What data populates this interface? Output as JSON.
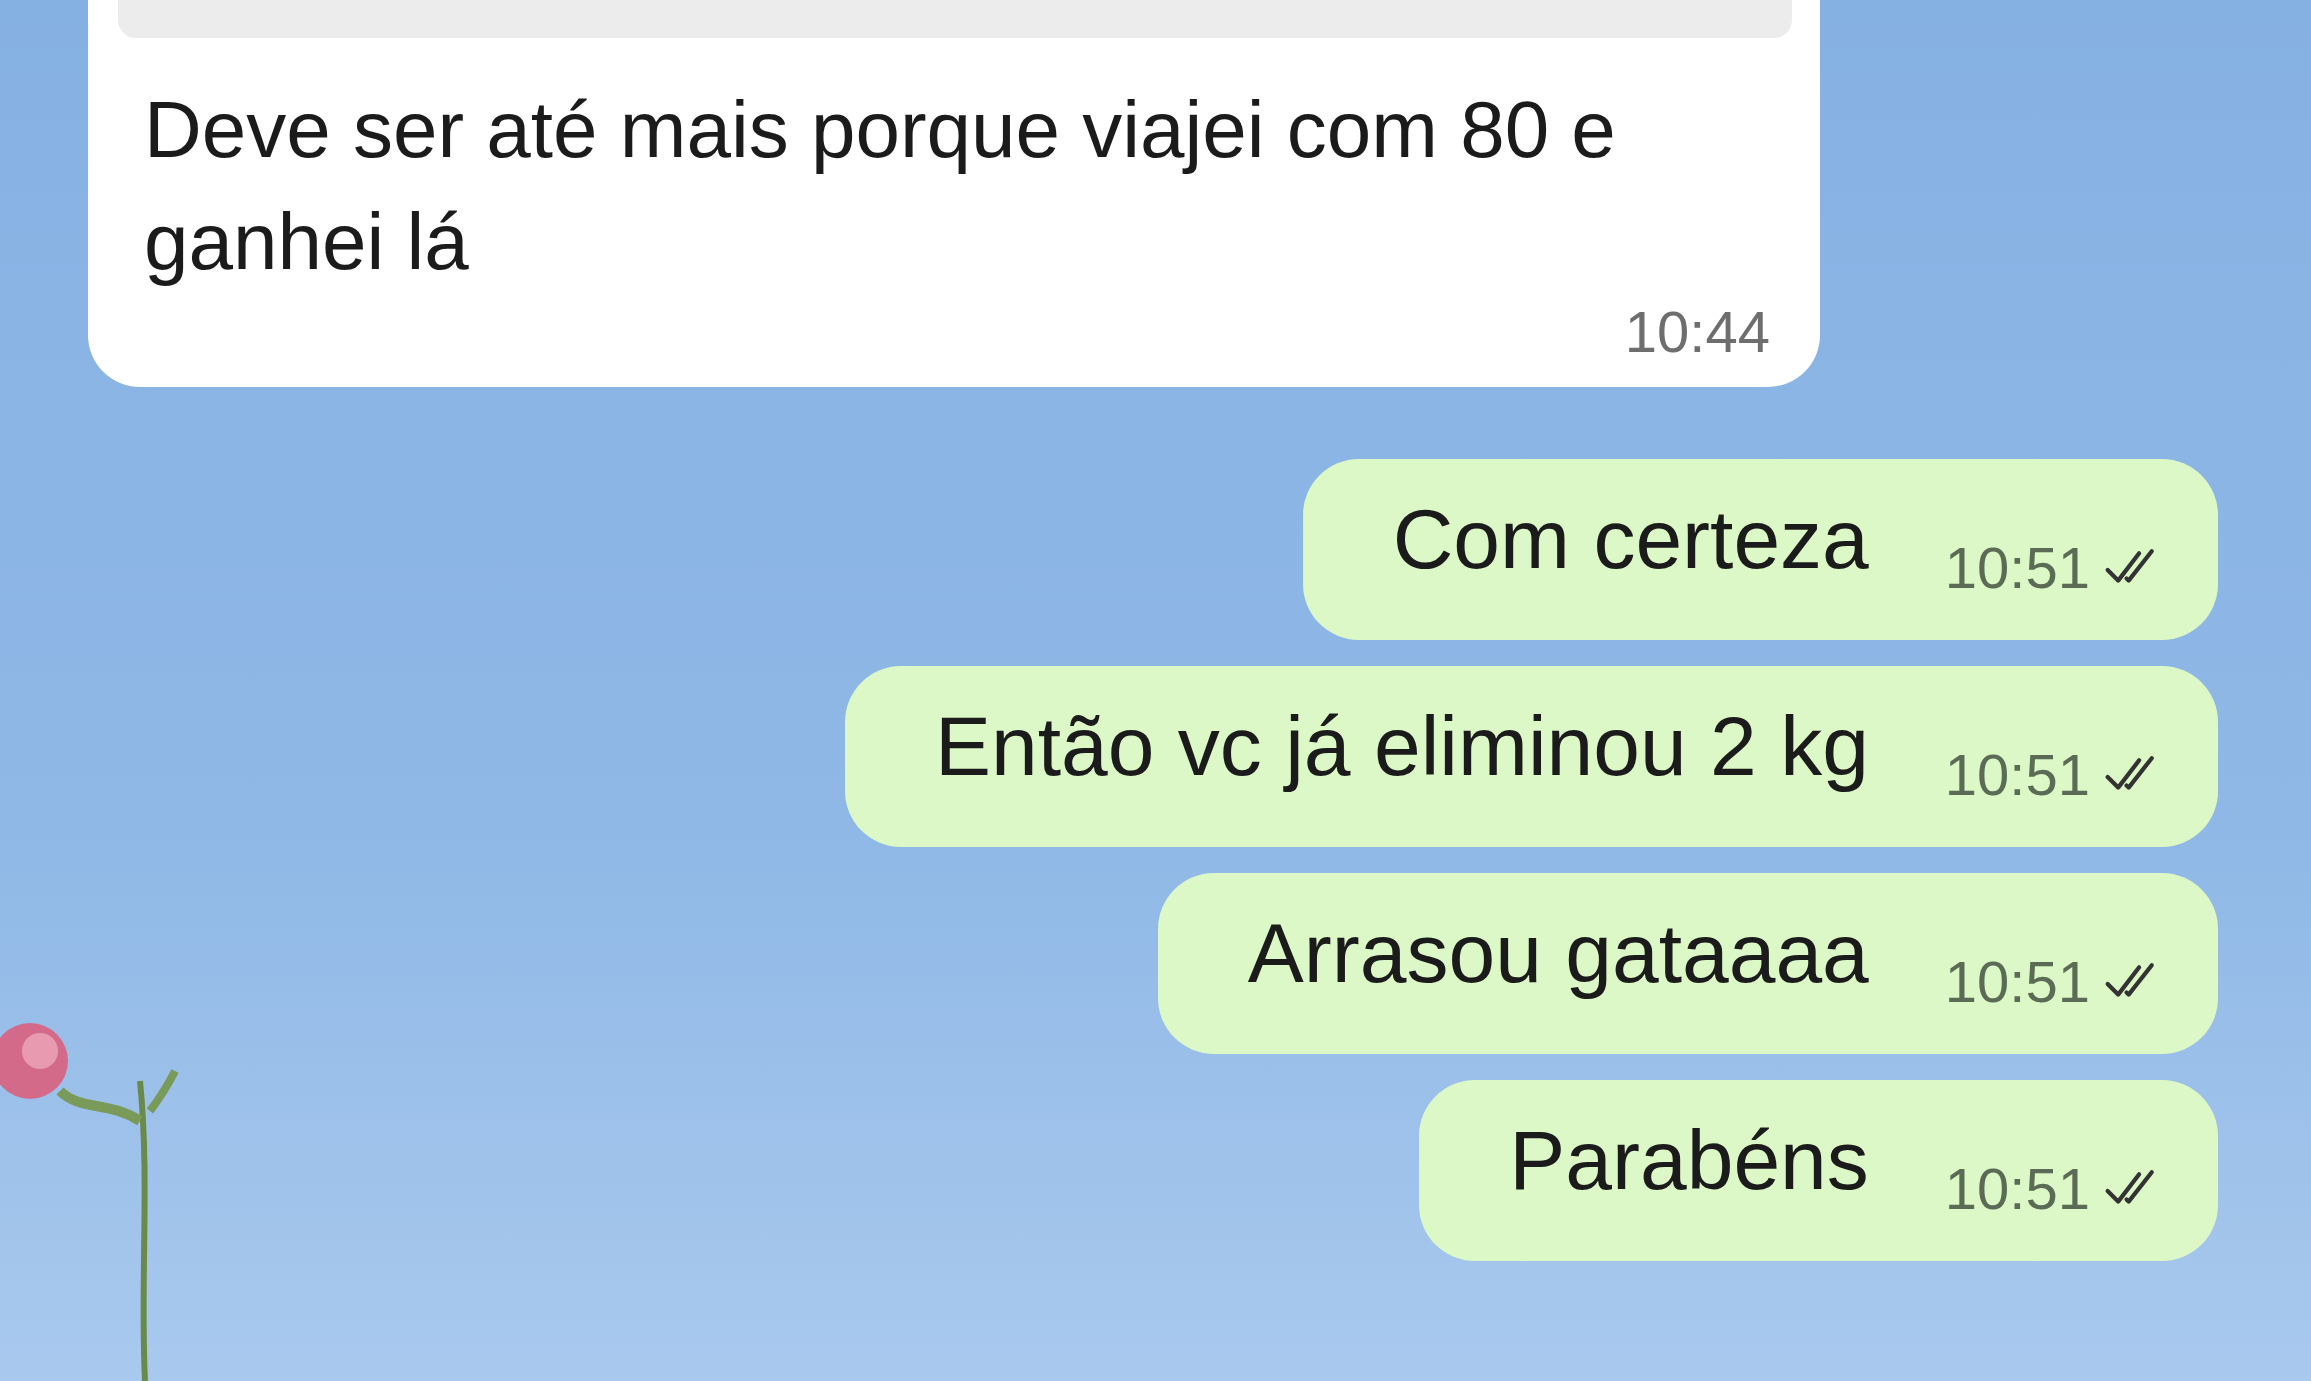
{
  "messages": [
    {
      "kind": "incoming",
      "has_reply_quote": true,
      "text": "Deve ser até mais porque viajei com 80 e ganhei lá",
      "time": "10:44",
      "double_check": false
    },
    {
      "kind": "outgoing",
      "has_reply_quote": false,
      "text": "Com certeza",
      "time": "10:51",
      "double_check": true
    },
    {
      "kind": "outgoing",
      "has_reply_quote": false,
      "text": "Então vc já eliminou 2 kg",
      "time": "10:51",
      "double_check": true
    },
    {
      "kind": "outgoing",
      "has_reply_quote": false,
      "text": "Arrasou gataaaa",
      "time": "10:51",
      "double_check": true
    },
    {
      "kind": "outgoing",
      "has_reply_quote": false,
      "text": "Parabéns",
      "time": "10:51",
      "double_check": true
    }
  ]
}
